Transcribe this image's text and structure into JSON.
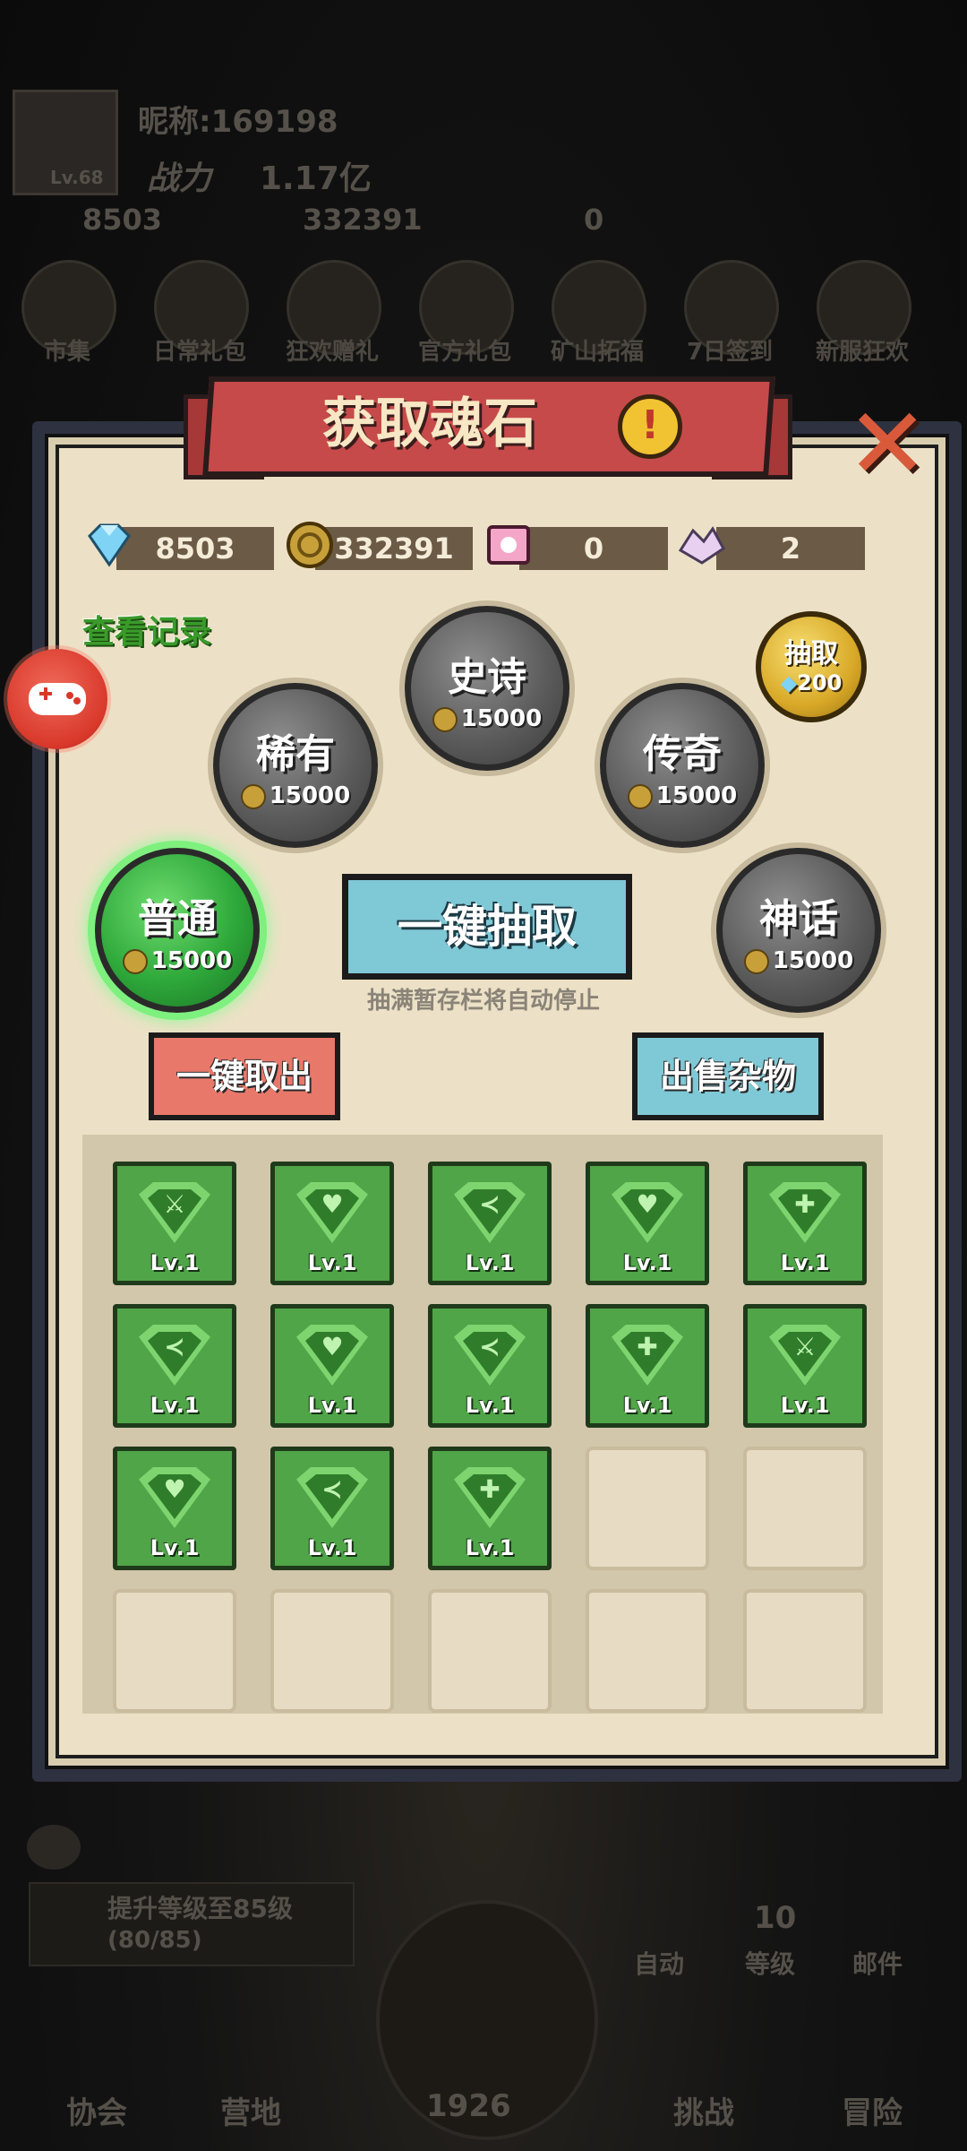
{
  "background": {
    "nickname": "昵称:169198",
    "level": "Lv.68",
    "power_label": "战力",
    "power_value": "1.17亿",
    "res_diamond": "8503",
    "res_gold": "332391",
    "res_other": "0",
    "top_icons": [
      "市集",
      "日常礼包",
      "狂欢赠礼",
      "官方礼包",
      "矿山拓福",
      "7日签到",
      "新服狂欢"
    ],
    "task_text": "提升等级至85级",
    "task_progress": "(80/85)",
    "side_labels": [
      "自动",
      "等级",
      "邮件"
    ],
    "level_num": "10",
    "bottom_nav": [
      "协会",
      "营地",
      "1926",
      "挑战",
      "冒险"
    ]
  },
  "panel": {
    "title": "获取魂石",
    "info_icon": "!",
    "close_icon": "✕",
    "currencies": [
      {
        "icon": "diamond-icon",
        "value": "8503"
      },
      {
        "icon": "gold-coin-icon",
        "value": "332391"
      },
      {
        "icon": "ticket-icon",
        "value": "0"
      },
      {
        "icon": "crystal-icon",
        "value": "2"
      }
    ],
    "view_records": "查看记录",
    "orbs": [
      {
        "name": "普通",
        "cost": "15000",
        "active": true
      },
      {
        "name": "稀有",
        "cost": "15000",
        "active": false
      },
      {
        "name": "史诗",
        "cost": "15000",
        "active": false
      },
      {
        "name": "传奇",
        "cost": "15000",
        "active": false
      },
      {
        "name": "神话",
        "cost": "15000",
        "active": false
      }
    ],
    "gold_orb": {
      "label": "抽取",
      "cost": "200"
    },
    "one_click_draw": "一键抽取",
    "hint": "抽满暂存栏将自动停止",
    "one_click_take": "一键取出",
    "sell_junk": "出售杂物",
    "slots": [
      {
        "type": "sword",
        "lv": "Lv.1"
      },
      {
        "type": "heart",
        "lv": "Lv.1"
      },
      {
        "type": "boot",
        "lv": "Lv.1"
      },
      {
        "type": "heart",
        "lv": "Lv.1"
      },
      {
        "type": "shield",
        "lv": "Lv.1"
      },
      {
        "type": "boot",
        "lv": "Lv.1"
      },
      {
        "type": "heart",
        "lv": "Lv.1"
      },
      {
        "type": "boot",
        "lv": "Lv.1"
      },
      {
        "type": "shield",
        "lv": "Lv.1"
      },
      {
        "type": "sword",
        "lv": "Lv.1"
      },
      {
        "type": "heart",
        "lv": "Lv.1"
      },
      {
        "type": "boot",
        "lv": "Lv.1"
      },
      {
        "type": "shield",
        "lv": "Lv.1"
      },
      {
        "type": "empty",
        "lv": ""
      },
      {
        "type": "empty",
        "lv": ""
      },
      {
        "type": "empty",
        "lv": ""
      },
      {
        "type": "empty",
        "lv": ""
      },
      {
        "type": "empty",
        "lv": ""
      },
      {
        "type": "empty",
        "lv": ""
      },
      {
        "type": "empty",
        "lv": ""
      }
    ]
  },
  "colors": {
    "accent_red": "#c64a4a",
    "button_blue": "#7fc8d6",
    "button_red": "#e8786a",
    "gem_green": "#4fa548"
  }
}
